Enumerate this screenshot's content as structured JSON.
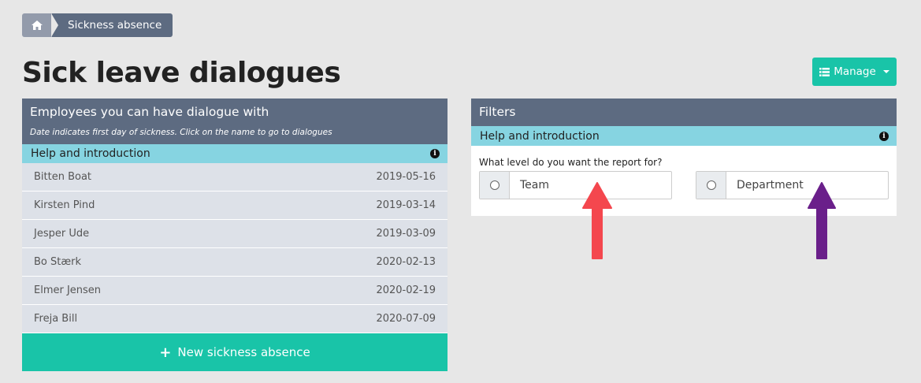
{
  "breadcrumb": {
    "home_icon": "home-icon",
    "current": "Sickness absence"
  },
  "page_title": "Sick leave dialogues",
  "manage_button": {
    "label": "Manage",
    "icon": "list-icon"
  },
  "employees_panel": {
    "title": "Employees you can have dialogue with",
    "subtitle": "Date indicates first day of sickness. Click on the name to go to dialogues",
    "help_label": "Help and introduction",
    "rows": [
      {
        "name": "Bitten Boat",
        "date": "2019-05-16"
      },
      {
        "name": "Kirsten Pind",
        "date": "2019-03-14"
      },
      {
        "name": "Jesper Ude",
        "date": "2019-03-09"
      },
      {
        "name": "Bo Stærk",
        "date": "2020-02-13"
      },
      {
        "name": "Elmer Jensen",
        "date": "2020-02-19"
      },
      {
        "name": "Freja Bill",
        "date": "2020-07-09"
      }
    ],
    "new_button": "New sickness absence"
  },
  "filters_panel": {
    "title": "Filters",
    "help_label": "Help and introduction",
    "question": "What level do you want the report for?",
    "options": [
      {
        "label": "Team"
      },
      {
        "label": "Department"
      }
    ]
  },
  "annotations": {
    "arrow_team_color": "#f4474e",
    "arrow_department_color": "#6a1f8a"
  },
  "colors": {
    "header": "#5d6b81",
    "help_bar": "#86d4e1",
    "accent": "#19c4a8",
    "row_bg": "#dde1e8"
  }
}
